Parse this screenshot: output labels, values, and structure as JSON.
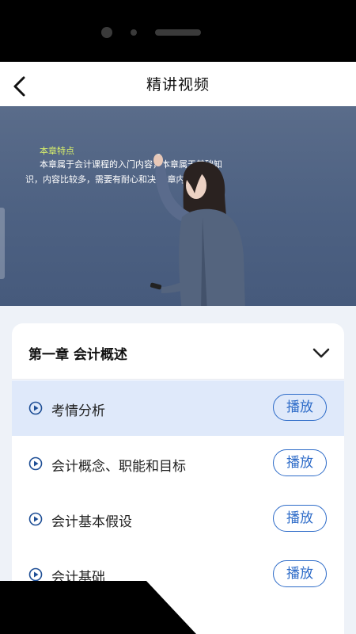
{
  "nav": {
    "title": "精讲视频",
    "back_icon": "back-arrow-icon"
  },
  "video": {
    "heading": "本章特点",
    "body_line1": "本章属于会计课程的入门内容，本章属于基础知",
    "body_line2": "识，内容比较多，需要有耐心和决心 章内容。"
  },
  "chapter": {
    "title": "第一章 会计概述",
    "expand_icon": "chevron-down-icon"
  },
  "lessons": [
    {
      "label": "考情分析",
      "button": "播放",
      "active": true
    },
    {
      "label": "会计概念、职能和目标",
      "button": "播放",
      "active": false
    },
    {
      "label": "会计基本假设",
      "button": "播放",
      "active": false
    },
    {
      "label": "会计基础",
      "button": "播放",
      "active": false
    }
  ],
  "colors": {
    "accent": "#2d6bc8",
    "active_row": "#dfe9fa",
    "video_heading": "#d9f06a",
    "page_bg": "#eef2f8"
  }
}
